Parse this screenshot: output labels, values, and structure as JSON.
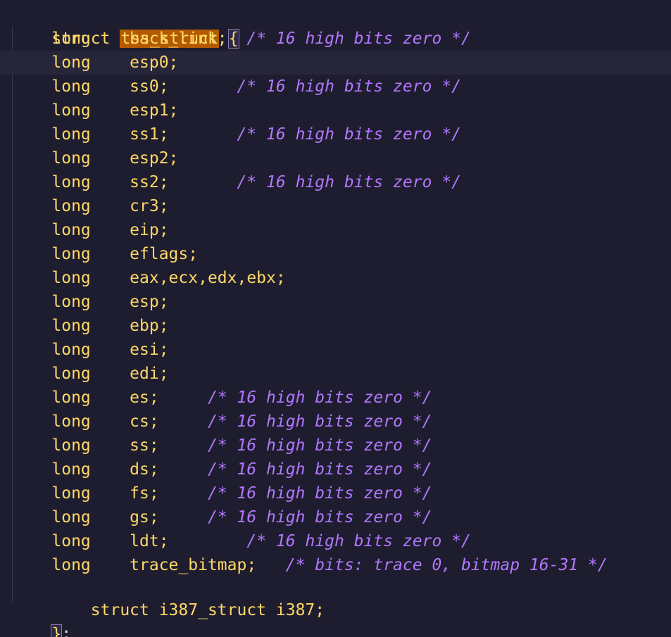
{
  "editor": {
    "header": {
      "keyword": "struct",
      "name": "tss_struct",
      "open_brace": "{"
    },
    "fields": [
      {
        "type": "long",
        "name": "back_link;",
        "pad": "  ",
        "comment": "/* 16 high bits zero */"
      },
      {
        "type": "long",
        "name": "esp0;",
        "pad": "",
        "comment": ""
      },
      {
        "type": "long",
        "name": "ss0;",
        "pad": "       ",
        "comment": "/* 16 high bits zero */"
      },
      {
        "type": "long",
        "name": "esp1;",
        "pad": "",
        "comment": ""
      },
      {
        "type": "long",
        "name": "ss1;",
        "pad": "       ",
        "comment": "/* 16 high bits zero */"
      },
      {
        "type": "long",
        "name": "esp2;",
        "pad": "",
        "comment": ""
      },
      {
        "type": "long",
        "name": "ss2;",
        "pad": "       ",
        "comment": "/* 16 high bits zero */"
      },
      {
        "type": "long",
        "name": "cr3;",
        "pad": "",
        "comment": ""
      },
      {
        "type": "long",
        "name": "eip;",
        "pad": "",
        "comment": ""
      },
      {
        "type": "long",
        "name": "eflags;",
        "pad": "",
        "comment": ""
      },
      {
        "type": "long",
        "name": "eax,ecx,edx,ebx;",
        "pad": "",
        "comment": ""
      },
      {
        "type": "long",
        "name": "esp;",
        "pad": "",
        "comment": ""
      },
      {
        "type": "long",
        "name": "ebp;",
        "pad": "",
        "comment": ""
      },
      {
        "type": "long",
        "name": "esi;",
        "pad": "",
        "comment": ""
      },
      {
        "type": "long",
        "name": "edi;",
        "pad": "",
        "comment": ""
      },
      {
        "type": "long",
        "name": "es;",
        "pad": "     ",
        "comment": "/* 16 high bits zero */"
      },
      {
        "type": "long",
        "name": "cs;",
        "pad": "     ",
        "comment": "/* 16 high bits zero */"
      },
      {
        "type": "long",
        "name": "ss;",
        "pad": "     ",
        "comment": "/* 16 high bits zero */"
      },
      {
        "type": "long",
        "name": "ds;",
        "pad": "     ",
        "comment": "/* 16 high bits zero */"
      },
      {
        "type": "long",
        "name": "fs;",
        "pad": "     ",
        "comment": "/* 16 high bits zero */"
      },
      {
        "type": "long",
        "name": "gs;",
        "pad": "     ",
        "comment": "/* 16 high bits zero */"
      },
      {
        "type": "long",
        "name": "ldt;",
        "pad": "        ",
        "comment": "/* 16 high bits zero */"
      },
      {
        "type": "long",
        "name": "trace_bitmap;",
        "pad": "   ",
        "comment": "/* bits: trace 0, bitmap 16-31 */"
      }
    ],
    "last_member": "struct i387_struct i387;",
    "close_brace": "}",
    "close_semicolon": ";",
    "colors": {
      "background": "#1e1d2f",
      "current_line": "#262539",
      "code": "#ffd866",
      "comment": "#b277ff",
      "name_highlight": "#b35a00"
    }
  }
}
